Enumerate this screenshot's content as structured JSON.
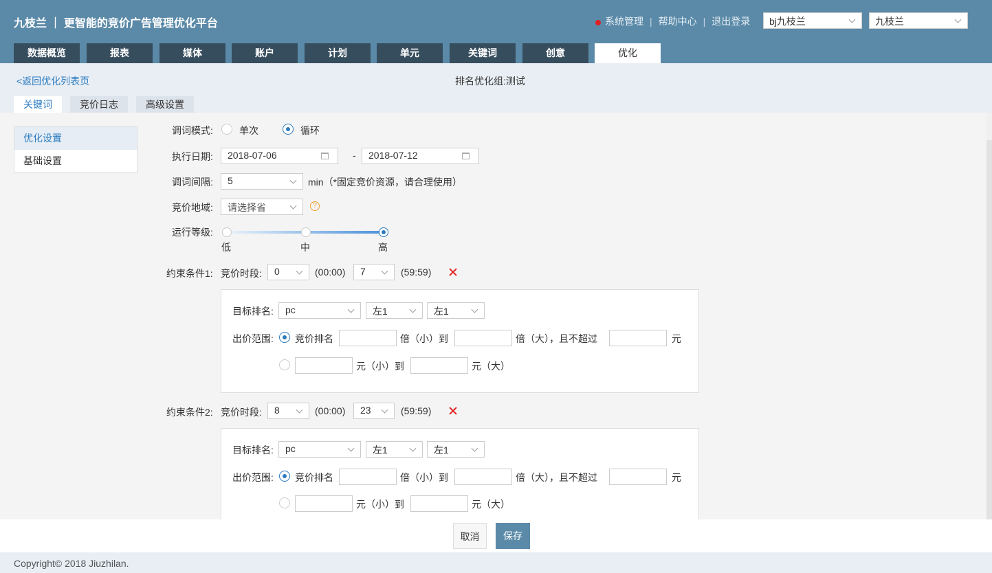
{
  "header": {
    "brand": "九枝兰 ｜ 更智能的竞价广告管理优化平台",
    "links": [
      "系统管理",
      "帮助中心",
      "退出登录"
    ],
    "account_select": "bj九枝兰",
    "user_select": "九枝兰"
  },
  "nav": {
    "tabs": [
      "数据概览",
      "报表",
      "媒体",
      "账户",
      "计划",
      "单元",
      "关键词",
      "创意",
      "优化"
    ],
    "active_index": 8
  },
  "page": {
    "back_link": "<返回优化列表页",
    "group_title": "排名优化组:测试",
    "subtabs": [
      "关键词",
      "竞价日志",
      "高级设置"
    ]
  },
  "sidebar": {
    "items": [
      "优化设置",
      "基础设置"
    ]
  },
  "form": {
    "mode_label": "调词模式:",
    "mode_single": "单次",
    "mode_loop": "循环",
    "date_label": "执行日期:",
    "date_start": "2018-07-06",
    "date_sep": "-",
    "date_end": "2018-07-12",
    "interval_label": "调词间隔:",
    "interval_value": "5",
    "interval_note": "min（*固定竞价资源，请合理使用）",
    "region_label": "竞价地域:",
    "region_placeholder": "请选择省",
    "level_label": "运行等级:",
    "level_low": "低",
    "level_mid": "中",
    "level_high": "高"
  },
  "conditions": [
    {
      "label": "约束条件1:",
      "period_label": "竞价时段:",
      "start_hour": "0",
      "start_suffix": "(00:00)",
      "end_hour": "7",
      "end_suffix": "(59:59)",
      "target_label": "目标排名:",
      "device": "pc",
      "pos1": "左1",
      "pos2": "左1",
      "range_label": "出价范围:",
      "rank_opt": "竞价排名",
      "times_small_to": "倍（小）到",
      "times_big_limit": "倍（大），且不超过",
      "yuan": "元",
      "yuan_small_to": "元（小）到",
      "yuan_big": "元（大）"
    },
    {
      "label": "约束条件2:",
      "period_label": "竞价时段:",
      "start_hour": "8",
      "start_suffix": "(00:00)",
      "end_hour": "23",
      "end_suffix": "(59:59)",
      "target_label": "目标排名:",
      "device": "pc",
      "pos1": "左1",
      "pos2": "左1",
      "range_label": "出价范围:",
      "rank_opt": "竞价排名",
      "times_small_to": "倍（小）到",
      "times_big_limit": "倍（大），且不超过",
      "yuan": "元",
      "yuan_small_to": "元（小）到",
      "yuan_big": "元（大）"
    }
  ],
  "actions": {
    "cancel": "取消",
    "save": "保存"
  },
  "footer": {
    "copyright": "Copyright© 2018 Jiuzhilan."
  }
}
